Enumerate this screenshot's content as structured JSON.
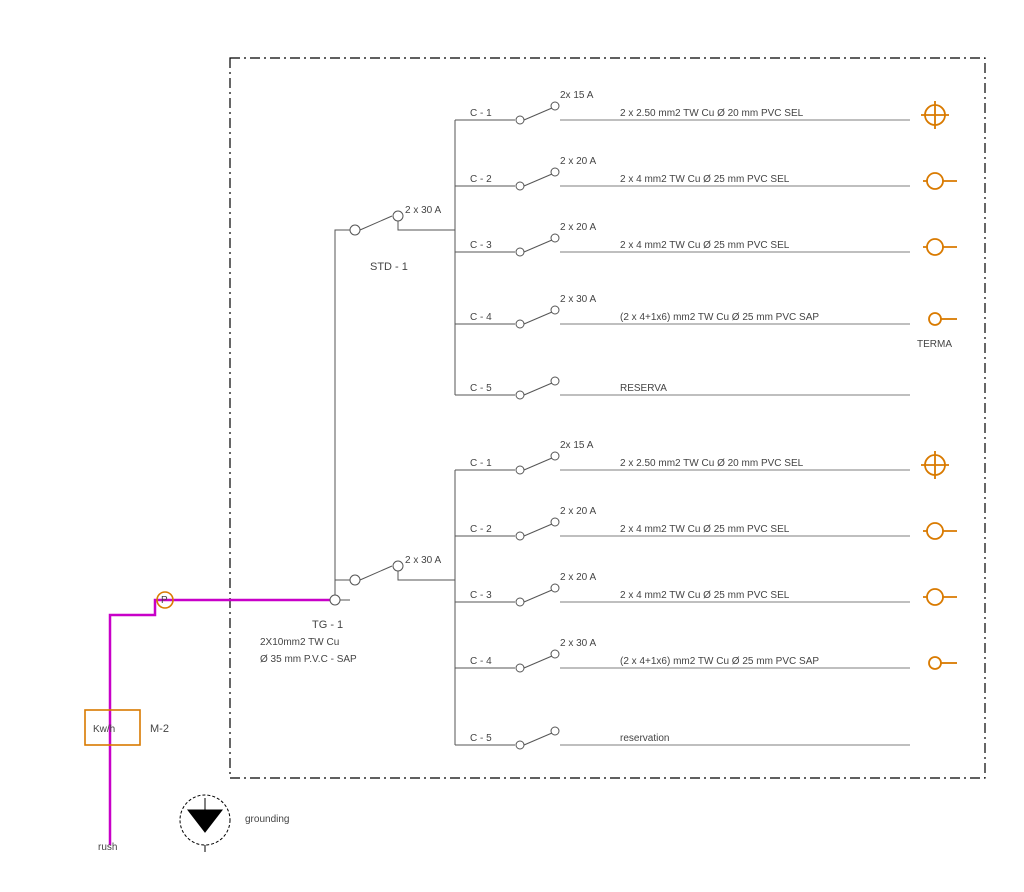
{
  "meter": {
    "label": "Kw/h",
    "id": "M-2"
  },
  "feeder": {
    "label": "rush"
  },
  "ground": {
    "label": "grounding"
  },
  "incoming": {
    "name": "TG - 1",
    "spec1": "2X10mm2 TW Cu",
    "spec2": "Ø 35 mm P.V.C - SAP"
  },
  "subboard": {
    "name": "STD - 1",
    "breaker": "2 x 30 A",
    "circuits": [
      {
        "id": "C - 1",
        "rating": "2x 15 A",
        "cable": "2 x 2.50  mm2  TW Cu Ø  20  mm PVC SEL",
        "icon": "light"
      },
      {
        "id": "C - 2",
        "rating": "2 x 20 A",
        "cable": "2 x 4  mm2  TW Cu Ø  25  mm PVC SEL",
        "icon": "outlet"
      },
      {
        "id": "C - 3",
        "rating": "2 x 20 A",
        "cable": "2 x 4  mm2  TW Cu Ø  25  mm PVC SEL",
        "icon": "outlet"
      },
      {
        "id": "C - 4",
        "rating": "2 x 30 A",
        "cable": "(2 x 4+1x6)  mm2  TW Cu Ø  25  mm PVC SAP",
        "icon": "heater",
        "iconlabel": "TERMA"
      },
      {
        "id": "C - 5",
        "rating": "",
        "cable": "RESERVA",
        "icon": ""
      }
    ]
  },
  "mainboard": {
    "breaker": "2 x 30 A",
    "circuits": [
      {
        "id": "C - 1",
        "rating": "2x 15 A",
        "cable": "2 x 2.50  mm2  TW Cu Ø  20  mm PVC SEL",
        "icon": "light"
      },
      {
        "id": "C - 2",
        "rating": "2 x 20 A",
        "cable": "2 x 4  mm2  TW Cu Ø  25  mm PVC SEL",
        "icon": "outlet"
      },
      {
        "id": "C - 3",
        "rating": "2 x 20 A",
        "cable": "2 x 4  mm2  TW Cu Ø  25  mm PVC SEL",
        "icon": "outlet"
      },
      {
        "id": "C - 4",
        "rating": "2 x 30 A",
        "cable": "(2 x 4+1x6)  mm2  TW Cu Ø  25  mm PVC SAP",
        "icon": "heater"
      },
      {
        "id": "C - 5",
        "rating": "",
        "cable": "reservation",
        "icon": ""
      }
    ]
  }
}
